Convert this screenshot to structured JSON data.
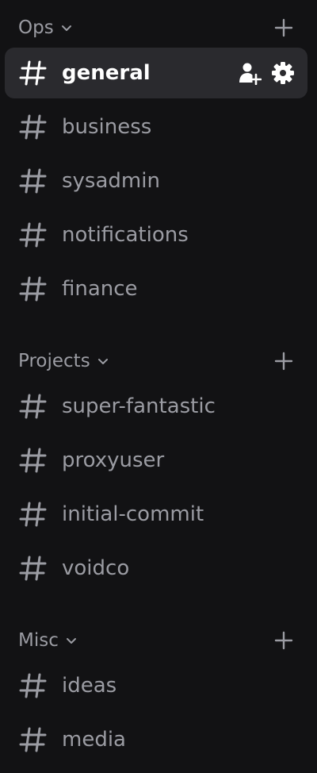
{
  "colors": {
    "background": "#121214",
    "active_row": "#2a2a2e",
    "muted_text": "#9b9ca3",
    "active_text": "#ffffff"
  },
  "categories": [
    {
      "label": "Ops",
      "chevron_icon": "chevron-down-icon",
      "add_icon": "plus-icon",
      "channels": [
        {
          "name": "general",
          "active": true,
          "actions": [
            "add-member-icon",
            "gear-icon"
          ]
        },
        {
          "name": "business"
        },
        {
          "name": "sysadmin"
        },
        {
          "name": "notifications"
        },
        {
          "name": "finance"
        }
      ]
    },
    {
      "label": "Projects",
      "chevron_icon": "chevron-down-icon",
      "add_icon": "plus-icon",
      "channels": [
        {
          "name": "super-fantastic"
        },
        {
          "name": "proxyuser"
        },
        {
          "name": "initial-commit"
        },
        {
          "name": "voidco"
        }
      ]
    },
    {
      "label": "Misc",
      "chevron_icon": "chevron-down-icon",
      "add_icon": "plus-icon",
      "channels": [
        {
          "name": "ideas"
        },
        {
          "name": "media"
        }
      ]
    }
  ]
}
